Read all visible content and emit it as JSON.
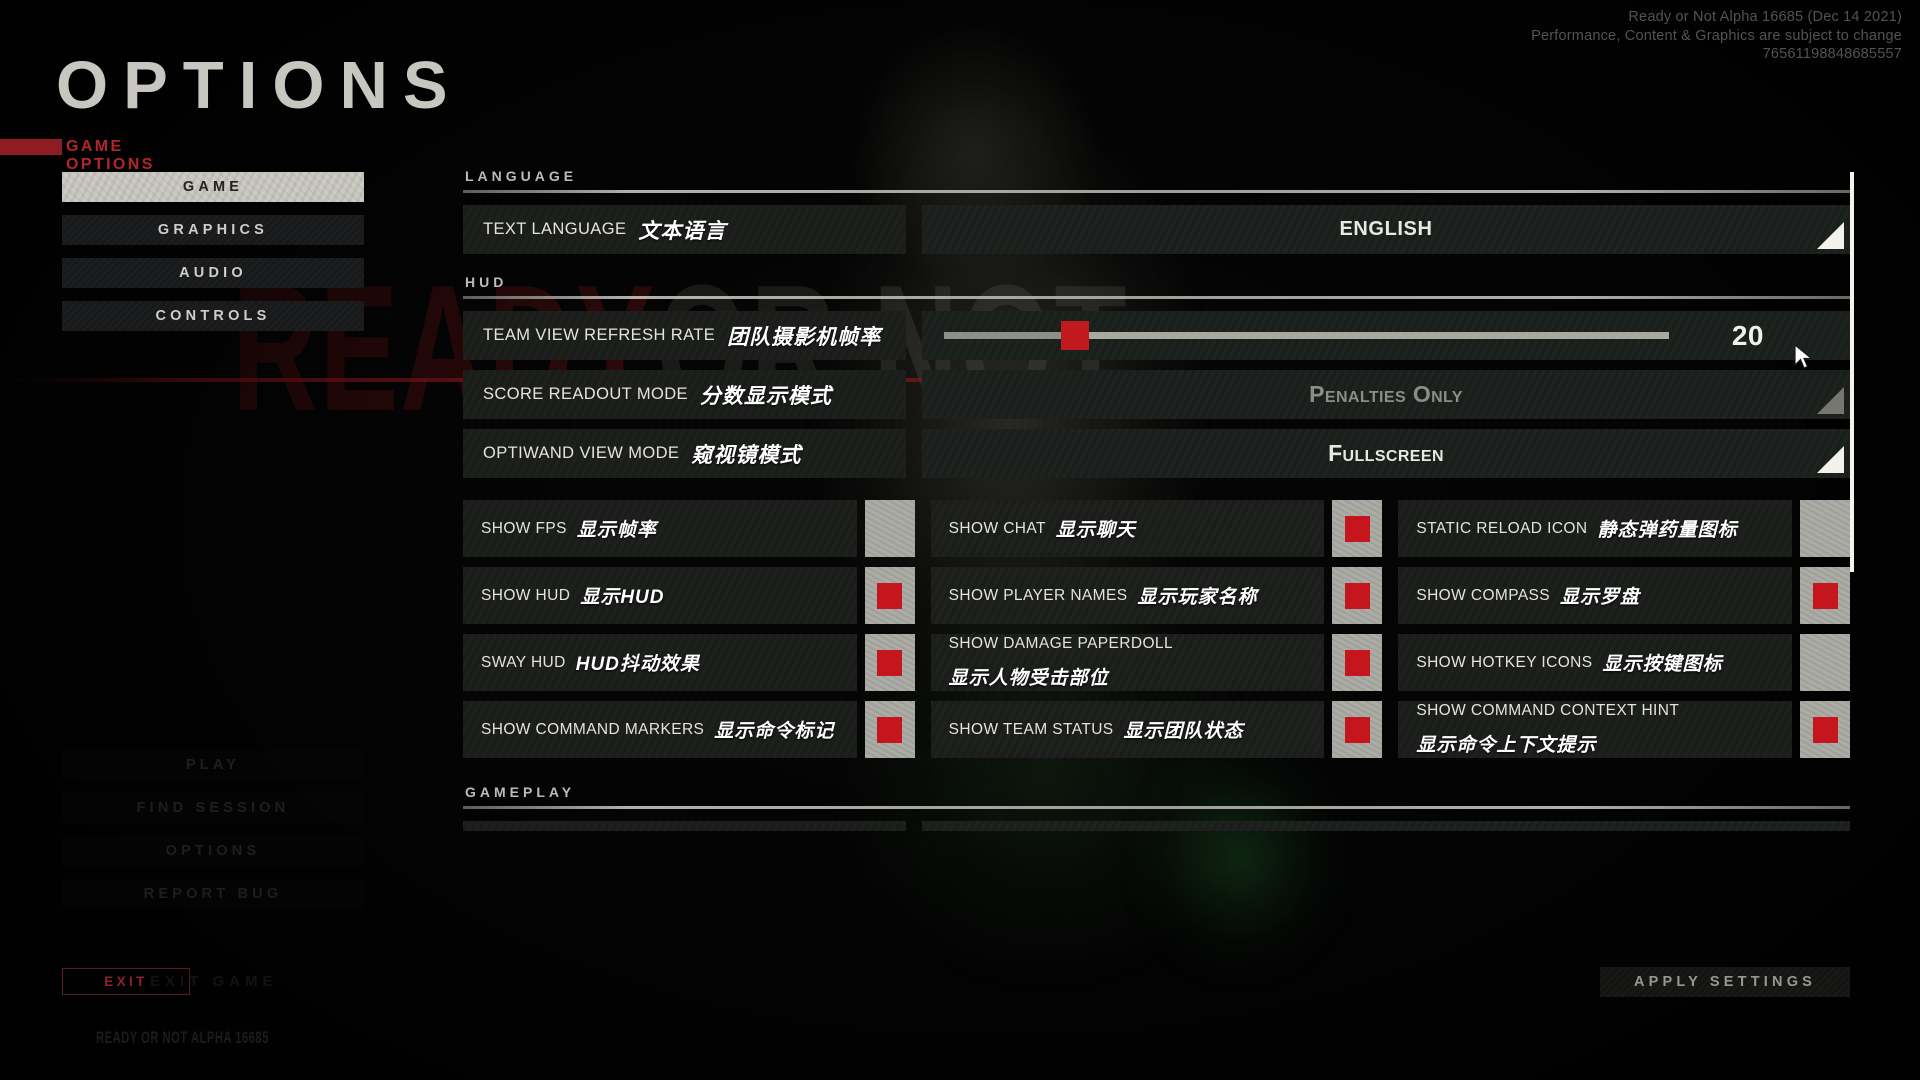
{
  "version": {
    "line1": "Ready or Not Alpha 16685 (Dec 14 2021)",
    "line2": "Performance, Content & Graphics are subject to change",
    "line3": "76561198848685557"
  },
  "header": {
    "title": "OPTIONS",
    "subtitle": "GAME OPTIONS"
  },
  "tabs": [
    {
      "label": "GAME",
      "active": true
    },
    {
      "label": "GRAPHICS",
      "active": false
    },
    {
      "label": "AUDIO",
      "active": false
    },
    {
      "label": "CONTROLS",
      "active": false
    }
  ],
  "main_menu": [
    {
      "label": "PLAY"
    },
    {
      "label": "FIND SESSION"
    },
    {
      "label": "OPTIONS"
    },
    {
      "label": "REPORT BUG"
    }
  ],
  "exit": {
    "label": "EXIT",
    "ghost_label": "EXIT GAME",
    "build_stamp": "READY OR NOT ALPHA 16685"
  },
  "apply": {
    "label": "APPLY SETTINGS"
  },
  "sections": {
    "language": {
      "title": "LANGUAGE",
      "rows": [
        {
          "label_en": "TEXT LANGUAGE",
          "label_cn": "文本语言",
          "type": "dropdown",
          "value": "ENGLISH"
        }
      ]
    },
    "hud": {
      "title": "HUD",
      "rows": [
        {
          "label_en": "TEAM VIEW REFRESH RATE",
          "label_cn": "团队摄影机帧率",
          "type": "slider",
          "value": "20",
          "percent": 18
        },
        {
          "label_en": "SCORE READOUT MODE",
          "label_cn": "分数显示模式",
          "type": "dropdown",
          "value": "Penalties Only"
        },
        {
          "label_en": "OPTIWAND VIEW MODE",
          "label_cn": "窥视镜模式",
          "type": "dropdown",
          "value": "Fullscreen"
        }
      ]
    },
    "gameplay": {
      "title": "GAMEPLAY"
    }
  },
  "checkbox_grid": {
    "columns": [
      [
        {
          "label_en": "SHOW FPS",
          "label_cn": "显示帧率",
          "checked": false
        },
        {
          "label_en": "SHOW HUD",
          "label_cn": "显示HUD",
          "checked": true
        },
        {
          "label_en": "SWAY HUD",
          "label_cn": "HUD抖动效果",
          "checked": true
        },
        {
          "label_en": "SHOW COMMAND MARKERS",
          "label_cn": "显示命令标记",
          "checked": true
        }
      ],
      [
        {
          "label_en": "SHOW CHAT",
          "label_cn": "显示聊天",
          "checked": true
        },
        {
          "label_en": "SHOW PLAYER NAMES",
          "label_cn": "显示玩家名称",
          "checked": true
        },
        {
          "label_en": "SHOW DAMAGE PAPERDOLL",
          "label_cn": "显示人物受击部位",
          "checked": true
        },
        {
          "label_en": "SHOW TEAM STATUS",
          "label_cn": "显示团队状态",
          "checked": true
        }
      ],
      [
        {
          "label_en": "STATIC RELOAD ICON",
          "label_cn": "静态弹药量图标",
          "checked": false
        },
        {
          "label_en": "SHOW COMPASS",
          "label_cn": "显示罗盘",
          "checked": true
        },
        {
          "label_en": "SHOW HOTKEY ICONS",
          "label_cn": "显示按键图标",
          "checked": false
        },
        {
          "label_en": "SHOW COMMAND CONTEXT HINT",
          "label_cn": "显示命令上下文提示",
          "checked": true
        }
      ]
    ]
  },
  "watermark": {
    "part1": "READY",
    "part2": "OR NOT"
  },
  "colors": {
    "accent_red": "#b0262c",
    "checkbox_red": "#c4161c",
    "slider_red": "#c01a1f",
    "panel_bg": "#1a1d1a",
    "text": "#e4e3dd"
  }
}
